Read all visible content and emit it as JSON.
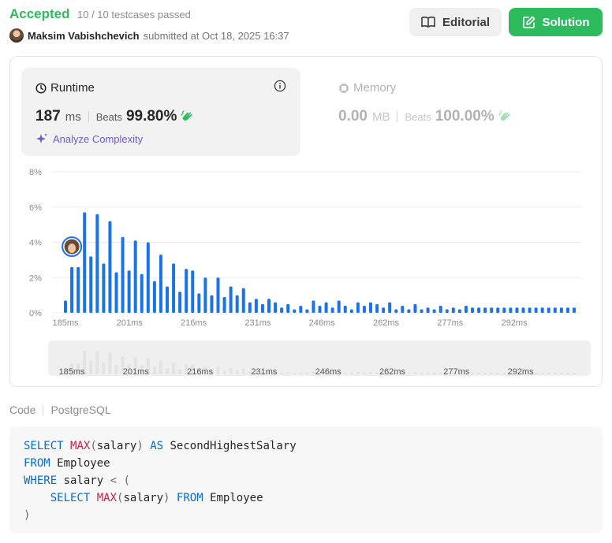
{
  "header": {
    "status": "Accepted",
    "testcases": "10 / 10 testcases passed",
    "user": "Maksim Vabishchevich",
    "submitted": "submitted at Oct 18, 2025 16:37",
    "editorial_label": "Editorial",
    "solution_label": "Solution"
  },
  "runtime": {
    "title": "Runtime",
    "value": "187",
    "unit": "ms",
    "beats_label": "Beats",
    "beats_pct": "99.80%",
    "analyze_label": "Analyze Complexity"
  },
  "memory": {
    "title": "Memory",
    "value": "0.00",
    "unit": "MB",
    "beats_label": "Beats",
    "beats_pct": "100.00%"
  },
  "chart_data": {
    "type": "bar",
    "ylabel": "",
    "xlabel": "",
    "y_ticks": [
      "8%",
      "6%",
      "4%",
      "2%",
      "0%"
    ],
    "ylim": [
      0,
      8
    ],
    "x_ticks": [
      "185ms",
      "201ms",
      "216ms",
      "231ms",
      "246ms",
      "262ms",
      "277ms",
      "292ms"
    ],
    "grid": true,
    "highlight_index": 2,
    "values": [
      0.7,
      2.6,
      2.6,
      5.7,
      3.2,
      5.6,
      2.8,
      5.2,
      2.3,
      4.3,
      2.4,
      4.1,
      2.2,
      4.0,
      1.8,
      3.3,
      1.5,
      2.8,
      1.2,
      2.5,
      2.4,
      1.1,
      2.0,
      1.0,
      2.0,
      0.9,
      1.5,
      1.0,
      1.4,
      0.6,
      0.8,
      0.5,
      0.8,
      0.6,
      0.3,
      0.5,
      0.2,
      0.4,
      0.2,
      0.7,
      0.4,
      0.6,
      0.3,
      0.7,
      0.4,
      0.2,
      0.6,
      0.4,
      0.6,
      0.5,
      0.3,
      0.6,
      0.2,
      0.4,
      0.2,
      0.5,
      0.2,
      0.3,
      0.2,
      0.4,
      0.2,
      0.3,
      0.2,
      0.4,
      0.3,
      0.3,
      0.3,
      0.3,
      0.3,
      0.3,
      0.3,
      0.3,
      0.3,
      0.3,
      0.3,
      0.3,
      0.3,
      0.3,
      0.3,
      0.3,
      0.3
    ]
  },
  "code": {
    "label": "Code",
    "language": "PostgreSQL",
    "lines": [
      [
        [
          "kw",
          "SELECT "
        ],
        [
          "fn",
          "MAX"
        ],
        [
          "pn",
          "("
        ],
        [
          "tx",
          "salary"
        ],
        [
          "pn",
          ")"
        ],
        [
          "kw",
          " AS "
        ],
        [
          "tx",
          "SecondHighestSalary"
        ]
      ],
      [
        [
          "kw",
          "FROM "
        ],
        [
          "tx",
          "Employee"
        ]
      ],
      [
        [
          "kw",
          "WHERE "
        ],
        [
          "tx",
          "salary "
        ],
        [
          "pn",
          "< ("
        ]
      ],
      [
        [
          "tx",
          "    "
        ],
        [
          "kw",
          "SELECT "
        ],
        [
          "fn",
          "MAX"
        ],
        [
          "pn",
          "("
        ],
        [
          "tx",
          "salary"
        ],
        [
          "pn",
          ")"
        ],
        [
          "kw",
          " FROM "
        ],
        [
          "tx",
          "Employee"
        ]
      ],
      [
        [
          "pn",
          ")"
        ]
      ]
    ]
  },
  "colors": {
    "accepted": "#2cbb5d",
    "bar": "#1a73e8",
    "bar_faded": "#e3e3e3",
    "analyze": "#6b5bd6"
  }
}
